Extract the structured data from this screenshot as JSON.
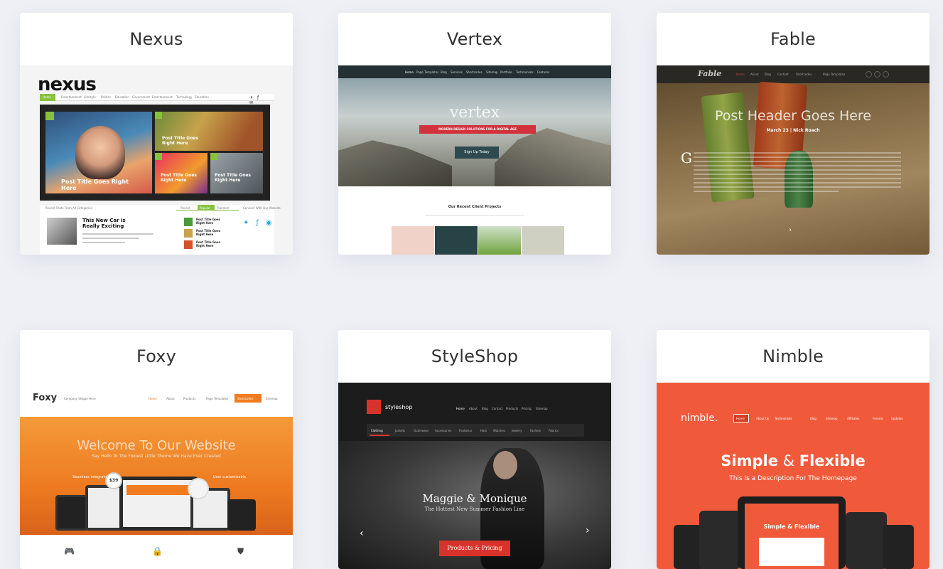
{
  "cards": [
    {
      "title": "Nexus",
      "logo": "nexus",
      "nav": [
        "Home",
        "Entertainment",
        "Lifestyle",
        "Politics",
        "Education",
        "Government",
        "Entertainment",
        "Technology",
        "Education"
      ],
      "hero_headline": "Post Title Goes Right Here",
      "feature_title": "This New Car is Really Exciting",
      "side_titles": [
        "Post Title Goes Right Here",
        "Post Title Goes Right Here",
        "Post Title Goes Right Here"
      ],
      "tabs": [
        "Recent",
        "Popular",
        "Random"
      ],
      "connect_label": "Connect With Our Website"
    },
    {
      "title": "Vertex",
      "nav": [
        "Home",
        "Page Templates",
        "Blog",
        "Services",
        "Shortcodes",
        "Sitemap",
        "Portfolio",
        "Testimonials",
        "Features"
      ],
      "hero_logo": "vertex",
      "banner": "MODERN DESIGN SOLUTIONS FOR A DIGITAL AGE",
      "cta": "Sign Up Today",
      "section_title": "Our Recent Client Projects"
    },
    {
      "title": "Fable",
      "logo": "Fable",
      "nav": [
        "Home",
        "About",
        "Blog",
        "Contact",
        "Shortcodes",
        "Page Templates"
      ],
      "headline": "Post Header Goes Here",
      "meta": "March 23 | Nick Roach",
      "drop_cap": "G"
    },
    {
      "title": "Foxy",
      "logo": "Foxy",
      "tagline": "Company Slogan Here",
      "nav": [
        "Home",
        "About",
        "Products",
        "Page Templates",
        "Shortcodes",
        "Sitemap"
      ],
      "headline": "Welcome To Our Website",
      "subhead": "Say Hello To The Foxiest Little Theme We Have Ever Created",
      "callouts": [
        "Seamless integration",
        "User customizable"
      ],
      "badge": "$39"
    },
    {
      "title": "StyleShop",
      "logo": "styleshop",
      "nav": [
        "Home",
        "About",
        "Blog",
        "Contact",
        "Products",
        "Pricing",
        "Sitemap"
      ],
      "categories": [
        "Clothing",
        "Jackets",
        "Outerwear",
        "Accessories",
        "Footwear",
        "Hats",
        "Watches",
        "Jewelry",
        "Fashion",
        "Fabrics"
      ],
      "headline": "Maggie & Monique",
      "subhead": "The Hottest New Summer Fashion Line",
      "cta": "Products & Pricing"
    },
    {
      "title": "Nimble",
      "logo": "nimble.",
      "nav": [
        "Home",
        "About Us",
        "Testimonials",
        "Blog",
        "Sitemap",
        "Affiliates",
        "Forums",
        "Updates"
      ],
      "headline_part1": "Simple",
      "amp": "&",
      "headline_part2": "Flexible",
      "subhead": "This Is a Description For The Homepage",
      "device_headline": "Simple & Flexible"
    }
  ],
  "colors": {
    "page_bg": "#eef0f5",
    "nexus_green": "#86c23c",
    "vertex_red": "#d2323c",
    "foxy_orange": "#f07c1f",
    "styleshop_red": "#d8332a",
    "nimble_orange": "#f05a3a"
  }
}
